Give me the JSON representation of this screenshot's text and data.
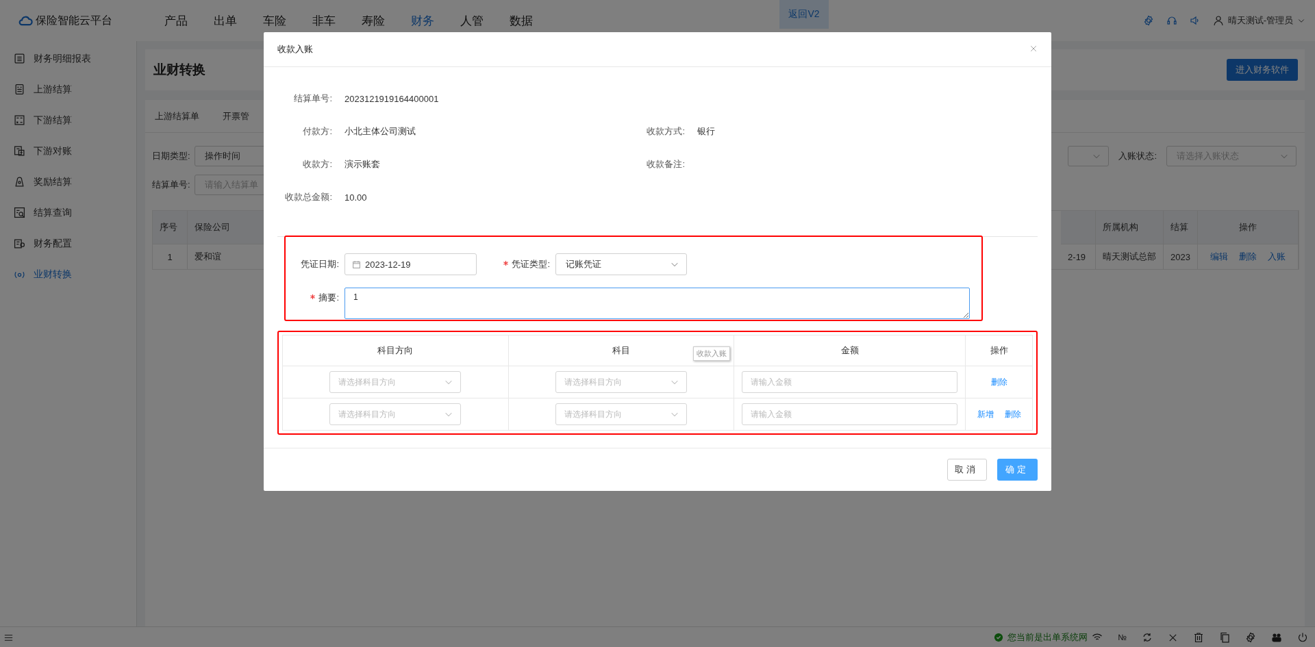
{
  "top_bar": {
    "logo": "保险智能云平台",
    "nav": [
      {
        "label": "产品",
        "selected": false
      },
      {
        "label": "出单",
        "selected": false
      },
      {
        "label": "车险",
        "selected": false
      },
      {
        "label": "非车",
        "selected": false
      },
      {
        "label": "寿险",
        "selected": false
      },
      {
        "label": "财务",
        "selected": true
      },
      {
        "label": "人管",
        "selected": false
      },
      {
        "label": "数据",
        "selected": false
      }
    ],
    "back_button": "返回V2",
    "user": "晴天测试-管理员"
  },
  "sidebar": {
    "items": [
      {
        "label": "财务明细报表",
        "selected": false
      },
      {
        "label": "上游结算",
        "selected": false
      },
      {
        "label": "下游结算",
        "selected": false
      },
      {
        "label": "下游对账",
        "selected": false
      },
      {
        "label": "奖励结算",
        "selected": false
      },
      {
        "label": "结算查询",
        "selected": false
      },
      {
        "label": "财务配置",
        "selected": false
      },
      {
        "label": "业财转换",
        "selected": true
      }
    ]
  },
  "page": {
    "title": "业财转换",
    "action_button": "进入财务软件",
    "tabs": [
      "上游结算单",
      "开票管"
    ],
    "filters": [
      {
        "kind": "select",
        "label": "日期类型:",
        "value": "操作时间"
      },
      {
        "kind": "input",
        "label": "结算单号:",
        "placeholder": "请输入结算单"
      }
    ],
    "right_filter": {
      "label": "入账状态:",
      "placeholder": "请选择入账状态"
    },
    "table": {
      "left_columns": [
        "序号",
        "保险公司"
      ],
      "right_columns": [
        "所属机构",
        "结算"
      ],
      "action_column": "操作",
      "rows": [
        {
          "left_cells": [
            "1",
            "爱和谊"
          ],
          "right_cells": [
            "2-19",
            "晴天测试总部",
            "2023"
          ],
          "actions": [
            "编辑",
            "删除",
            "入账"
          ]
        }
      ]
    }
  },
  "modal": {
    "title": "收款入账",
    "info_rows": [
      {
        "fields": [
          {
            "label": "结算单号:",
            "value": "2023121919164400001"
          }
        ]
      },
      {
        "fields": [
          {
            "label": "付款方:",
            "value": "小北主体公司测试"
          },
          {
            "label": "收款方式:",
            "value": "银行"
          }
        ]
      },
      {
        "fields": [
          {
            "label": "收款方:",
            "value": "演示账套"
          },
          {
            "label": "收款备注:"
          }
        ]
      },
      {
        "fields": [
          {
            "label": "收款总金额:",
            "value": "10.00"
          }
        ]
      }
    ],
    "voucher_date": {
      "label": "凭证日期:",
      "value": "2023-12-19"
    },
    "voucher_type": {
      "label": "凭证类型:",
      "value": "记账凭证",
      "required": true
    },
    "summary": {
      "label": "摘要:",
      "value": "1",
      "required": true
    },
    "entries": {
      "columns": [
        "科目方向",
        "科目",
        "金额",
        "操作"
      ],
      "rows": [
        {
          "direction_placeholder": "请选择科目方向",
          "subject_placeholder": "请选择科目方向",
          "amount_placeholder": "请输入金额",
          "actions": [
            "删除"
          ]
        },
        {
          "direction_placeholder": "请选择科目方向",
          "subject_placeholder": "请选择科目方向",
          "amount_placeholder": "请输入金额",
          "actions": [
            "新增",
            "删除"
          ]
        }
      ]
    },
    "tooltip": "收款入账",
    "cancel_button": "取消",
    "confirm_button": "确定"
  },
  "status_bar": {
    "message": "您当前是出单系统网",
    "number_sign": "№"
  }
}
